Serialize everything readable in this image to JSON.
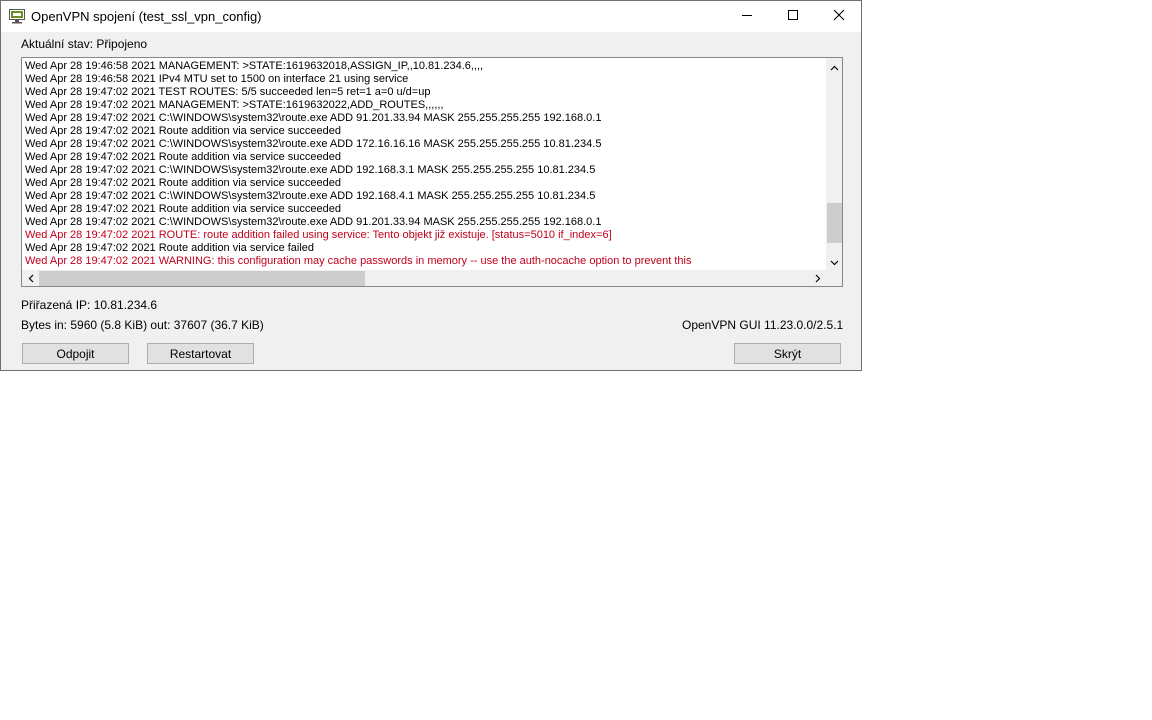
{
  "window": {
    "title": "OpenVPN spojení (test_ssl_vpn_config)"
  },
  "status": {
    "text": "Aktuální stav: Připojeno"
  },
  "log": {
    "lines": [
      {
        "text": "Wed Apr 28 19:46:58 2021 MANAGEMENT: >STATE:1619632018,ASSIGN_IP,,10.81.234.6,,,,",
        "level": "normal"
      },
      {
        "text": "Wed Apr 28 19:46:58 2021 IPv4 MTU set to 1500 on interface 21 using service",
        "level": "normal"
      },
      {
        "text": "Wed Apr 28 19:47:02 2021 TEST ROUTES: 5/5 succeeded len=5 ret=1 a=0 u/d=up",
        "level": "normal"
      },
      {
        "text": "Wed Apr 28 19:47:02 2021 MANAGEMENT: >STATE:1619632022,ADD_ROUTES,,,,,,",
        "level": "normal"
      },
      {
        "text": "Wed Apr 28 19:47:02 2021 C:\\WINDOWS\\system32\\route.exe ADD 91.201.33.94 MASK 255.255.255.255 192.168.0.1",
        "level": "normal"
      },
      {
        "text": "Wed Apr 28 19:47:02 2021 Route addition via service succeeded",
        "level": "normal"
      },
      {
        "text": "Wed Apr 28 19:47:02 2021 C:\\WINDOWS\\system32\\route.exe ADD 172.16.16.16 MASK 255.255.255.255 10.81.234.5",
        "level": "normal"
      },
      {
        "text": "Wed Apr 28 19:47:02 2021 Route addition via service succeeded",
        "level": "normal"
      },
      {
        "text": "Wed Apr 28 19:47:02 2021 C:\\WINDOWS\\system32\\route.exe ADD 192.168.3.1 MASK 255.255.255.255 10.81.234.5",
        "level": "normal"
      },
      {
        "text": "Wed Apr 28 19:47:02 2021 Route addition via service succeeded",
        "level": "normal"
      },
      {
        "text": "Wed Apr 28 19:47:02 2021 C:\\WINDOWS\\system32\\route.exe ADD 192.168.4.1 MASK 255.255.255.255 10.81.234.5",
        "level": "normal"
      },
      {
        "text": "Wed Apr 28 19:47:02 2021 Route addition via service succeeded",
        "level": "normal"
      },
      {
        "text": "Wed Apr 28 19:47:02 2021 C:\\WINDOWS\\system32\\route.exe ADD 91.201.33.94 MASK 255.255.255.255 192.168.0.1",
        "level": "normal"
      },
      {
        "text": "Wed Apr 28 19:47:02 2021 ROUTE: route addition failed using service: Tento objekt již existuje.   [status=5010 if_index=6]",
        "level": "error"
      },
      {
        "text": "Wed Apr 28 19:47:02 2021 Route addition via service failed",
        "level": "normal"
      },
      {
        "text": "Wed Apr 28 19:47:02 2021 WARNING: this configuration may cache passwords in memory -- use the auth-nocache option to prevent this",
        "level": "error"
      }
    ]
  },
  "info": {
    "assigned_ip": "Přiřazená IP: 10.81.234.6",
    "bytes": "Bytes in: 5960 (5.8 KiB)  out: 37607 (36.7 KiB)",
    "version": "OpenVPN GUI 11.23.0.0/2.5.1"
  },
  "buttons": {
    "disconnect": "Odpojit",
    "restart": "Restartovat",
    "hide": "Skrýt"
  },
  "icons": {
    "app": "openvpn-monitor-icon",
    "minimize": "minimize-icon",
    "maximize": "maximize-icon",
    "close": "close-icon"
  }
}
